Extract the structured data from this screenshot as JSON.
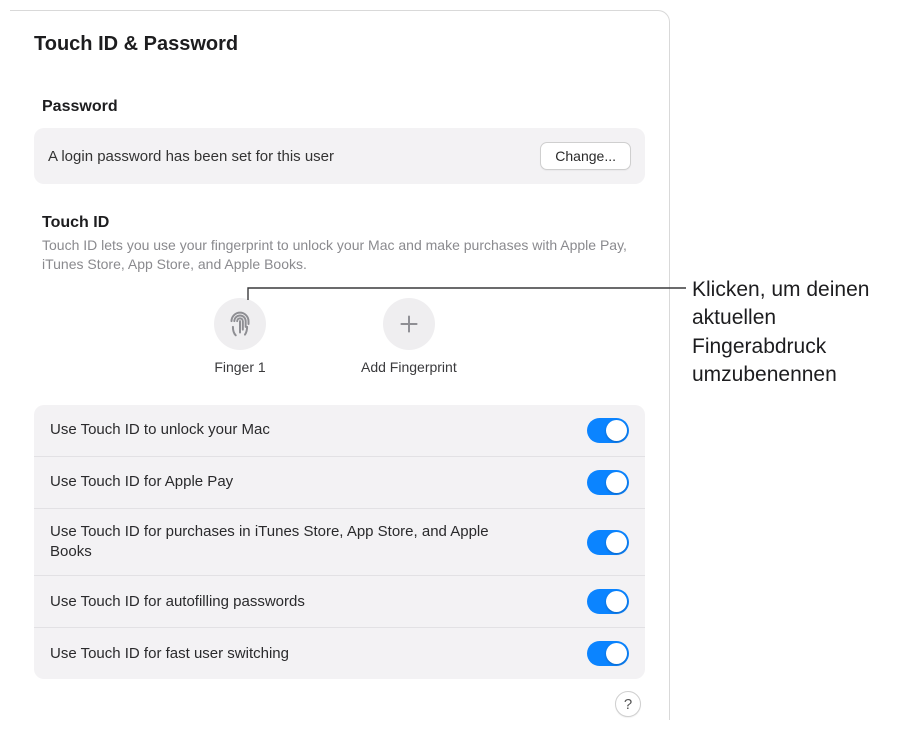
{
  "header": {
    "title": "Touch ID & Password"
  },
  "password": {
    "section_title": "Password",
    "status_text": "A login password has been set for this user",
    "change_label": "Change..."
  },
  "touchid": {
    "section_title": "Touch ID",
    "description": "Touch ID lets you use your fingerprint to unlock your Mac and make purchases with Apple Pay, iTunes Store, App Store, and Apple Books.",
    "fingerprints": [
      {
        "label": "Finger 1",
        "icon": "fingerprint-icon"
      },
      {
        "label": "Add Fingerprint",
        "icon": "plus-icon"
      }
    ],
    "options": [
      {
        "label": "Use Touch ID to unlock your Mac",
        "on": true
      },
      {
        "label": "Use Touch ID for Apple Pay",
        "on": true
      },
      {
        "label": "Use Touch ID for purchases in iTunes Store, App Store, and Apple Books",
        "on": true
      },
      {
        "label": "Use Touch ID for autofilling passwords",
        "on": true
      },
      {
        "label": "Use Touch ID for fast user switching",
        "on": true
      }
    ]
  },
  "help": {
    "label": "?"
  },
  "callout": {
    "text": "Klicken, um deinen aktuellen Fingerabdruck umzubenennen"
  }
}
